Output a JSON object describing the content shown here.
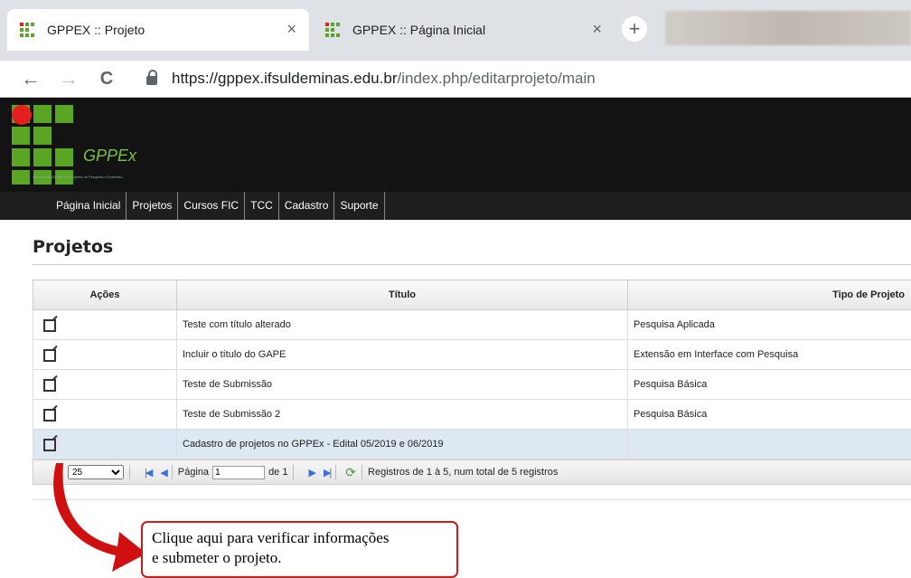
{
  "browser": {
    "tabs": [
      {
        "title": "GPPEX :: Projeto",
        "active": true
      },
      {
        "title": "GPPEX :: Página Inicial",
        "active": false
      }
    ],
    "close_glyph": "×",
    "new_tab_glyph": "+",
    "url_host": "https://gppex.ifsuldeminas.edu.br",
    "url_path": "/index.php/editarprojeto/main",
    "back_icon": "←",
    "forward_icon": "→",
    "reload_icon": "C"
  },
  "site": {
    "logo_text": "GPPEx",
    "logo_subtitle": "Sistema de Gestão de Projetos de Pesquisa e Extensão",
    "menu": [
      "Página Inicial",
      "Projetos",
      "Cursos FIC",
      "TCC",
      "Cadastro",
      "Suporte"
    ]
  },
  "content": {
    "title": "Projetos",
    "columns": [
      "Ações",
      "Título",
      "Tipo de Projeto"
    ],
    "rows": [
      {
        "titulo": "Teste com título alterado",
        "tipo": "Pesquisa Aplicada"
      },
      {
        "titulo": "Incluir o título do GAPE",
        "tipo": "Extensão em Interface com Pesquisa"
      },
      {
        "titulo": "Teste de Submissão",
        "tipo": "Pesquisa Básica"
      },
      {
        "titulo": "Teste de Submissão 2",
        "tipo": "Pesquisa Básica"
      },
      {
        "titulo": "Cadastro de projetos no GPPEx - Edital 05/2019 e 06/2019",
        "tipo": ""
      }
    ],
    "pager": {
      "page_size": "25",
      "page_label": "Página",
      "page_value": "1",
      "of_label": "de 1",
      "records": "Registros de 1 à 5, num total de 5 registros"
    }
  },
  "callout": {
    "line1": "Clique aqui para verificar informações",
    "line2": "e submeter o projeto."
  },
  "colors": {
    "brand_green": "#5aa624",
    "brand_red": "#e51e1e",
    "callout_red": "#cc1b1b"
  }
}
